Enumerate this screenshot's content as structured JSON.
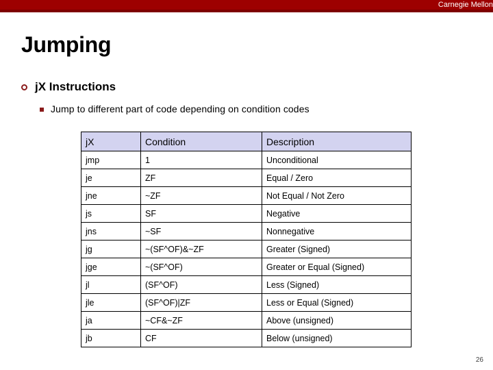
{
  "banner": {
    "brand": "Carnegie Mellon",
    "background_color": "#9d0000",
    "accent_color": "#7e0000"
  },
  "slide": {
    "title": "Jumping",
    "page_number": "26"
  },
  "bullets": {
    "level1": "jX Instructions",
    "level2": "Jump to different part of code depending on condition codes",
    "marker_color": "#8a1a1a"
  },
  "table": {
    "header_background": "#d3d3f0",
    "headers": [
      "jX",
      "Condition",
      "Description"
    ],
    "rows": [
      [
        "jmp",
        "1",
        "Unconditional"
      ],
      [
        "je",
        "ZF",
        "Equal / Zero"
      ],
      [
        "jne",
        "~ZF",
        "Not Equal / Not Zero"
      ],
      [
        "js",
        "SF",
        "Negative"
      ],
      [
        "jns",
        "~SF",
        "Nonnegative"
      ],
      [
        "jg",
        "~(SF^OF)&~ZF",
        "Greater (Signed)"
      ],
      [
        "jge",
        "~(SF^OF)",
        "Greater or Equal (Signed)"
      ],
      [
        "jl",
        "(SF^OF)",
        "Less (Signed)"
      ],
      [
        "jle",
        "(SF^OF)|ZF",
        "Less or Equal (Signed)"
      ],
      [
        "ja",
        "~CF&~ZF",
        "Above (unsigned)"
      ],
      [
        "jb",
        "CF",
        "Below (unsigned)"
      ]
    ]
  }
}
